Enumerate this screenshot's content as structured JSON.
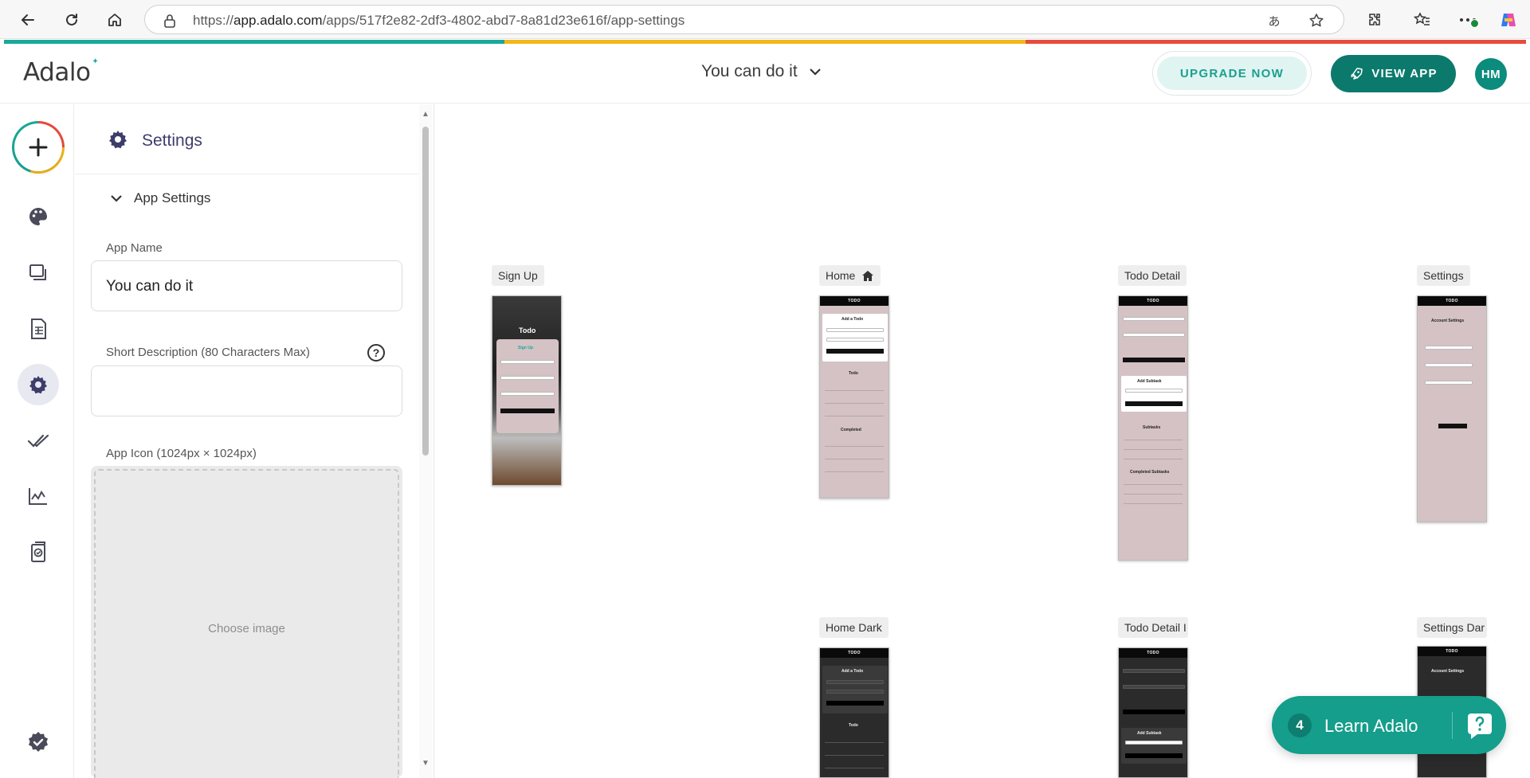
{
  "browser": {
    "url_prefix": "https://",
    "url_host": "app.adalo.com",
    "url_path": "/apps/517f2e82-2df3-4802-abd7-8a81d23e616f/app-settings"
  },
  "header": {
    "logo": "Adalo",
    "app_title": "You can do it",
    "upgrade_label": "UPGRADE NOW",
    "view_app_label": "VIEW APP",
    "avatar_initials": "HM"
  },
  "colors": {
    "accent": "#0b7a6c",
    "stripe_green": "#18a999",
    "stripe_yellow": "#f2b81a",
    "stripe_red": "#e74c3c",
    "panel_title": "#3d3d6b"
  },
  "rail": {
    "icons": [
      "add-icon",
      "palette-icon",
      "screens-icon",
      "database-icon",
      "settings-gear-icon",
      "double-check-icon",
      "analytics-icon",
      "publish-icon",
      "verified-icon"
    ]
  },
  "settings": {
    "title": "Settings",
    "section_label": "App Settings",
    "app_name_label": "App Name",
    "app_name_value": "You can do it",
    "short_desc_label": "Short Description (80 Characters Max)",
    "short_desc_value": "",
    "help_glyph": "?",
    "app_icon_label": "App Icon (1024px × 1024px)",
    "choose_image": "Choose image"
  },
  "canvas": {
    "screens": [
      {
        "label": "Sign Up",
        "home": false
      },
      {
        "label": "Home",
        "home": true
      },
      {
        "label": "Todo Detail",
        "home": false
      },
      {
        "label": "Settings",
        "home": false
      },
      {
        "label": "Home Dark",
        "home": false
      },
      {
        "label": "Todo Detail I",
        "home": false
      },
      {
        "label": "Settings Dar",
        "home": false
      }
    ],
    "mini": {
      "bar_title": "TODO",
      "signup_title": "Todo",
      "signup_heading": "Sign Up",
      "add_todo": "Add a Todo",
      "todo": "Todo",
      "completed": "Completed",
      "add_subtask": "Add Subtask",
      "subtasks": "Subtasks",
      "completed_subtasks": "Completed Subtasks",
      "account_settings": "Account Settings"
    }
  },
  "learn": {
    "count": "4",
    "label": "Learn Adalo"
  }
}
